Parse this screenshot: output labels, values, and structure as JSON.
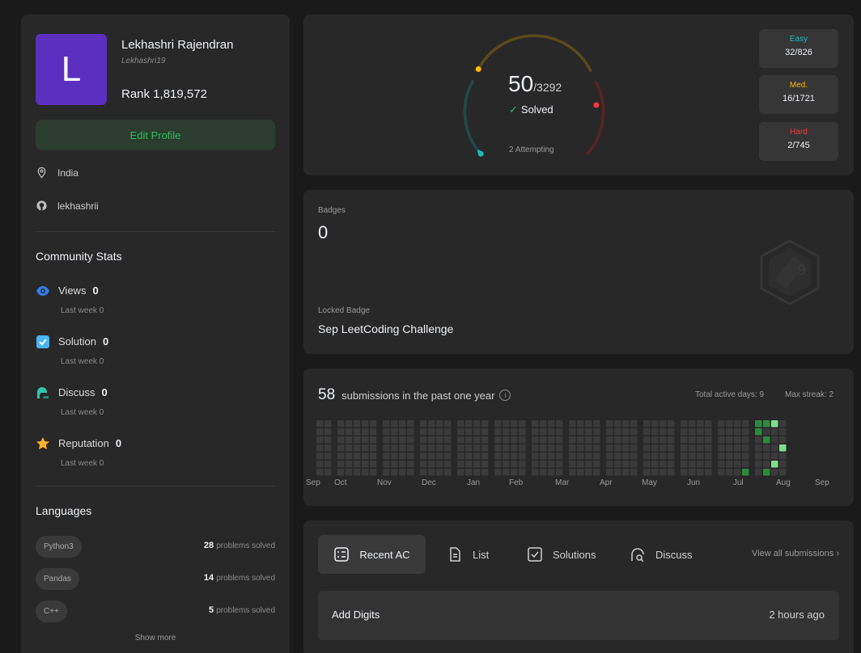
{
  "profile": {
    "avatar_letter": "L",
    "name": "Lekhashri Rajendran",
    "handle": "Lekhashri19",
    "rank": "Rank 1,819,572",
    "edit_label": "Edit Profile",
    "location": "India",
    "github": "lekhashrii"
  },
  "community": {
    "title": "Community Stats",
    "stats": [
      {
        "label": "Views",
        "value": "0",
        "last_week": "Last week 0",
        "icon": "eye-icon",
        "color": "#2f7fe9"
      },
      {
        "label": "Solution",
        "value": "0",
        "last_week": "Last week 0",
        "icon": "checkbox-icon",
        "color": "#4cb3f5"
      },
      {
        "label": "Discuss",
        "value": "0",
        "last_week": "Last week 0",
        "icon": "chat-icon",
        "color": "#2ec5a6"
      },
      {
        "label": "Reputation",
        "value": "0",
        "last_week": "Last week 0",
        "icon": "star-icon",
        "color": "#ffb22c"
      }
    ]
  },
  "languages": {
    "title": "Languages",
    "unit": "problems solved",
    "items": [
      {
        "name": "Python3",
        "count": "28"
      },
      {
        "name": "Pandas",
        "count": "14"
      },
      {
        "name": "C++",
        "count": "5"
      }
    ],
    "show_more": "Show more"
  },
  "solved": {
    "count": "50",
    "total": "/3292",
    "label": "Solved",
    "attempting": "2 Attempting",
    "easy": {
      "label": "Easy",
      "value": "32/826",
      "color": "#1cbaba",
      "solved": 32,
      "total": 826
    },
    "medium": {
      "label": "Med.",
      "value": "16/1721",
      "color": "#ffb700",
      "solved": 16,
      "total": 1721
    },
    "hard": {
      "label": "Hard",
      "value": "2/745",
      "color": "#f63737",
      "solved": 2,
      "total": 745
    }
  },
  "badges": {
    "label": "Badges",
    "count": "0",
    "locked_label": "Locked Badge",
    "locked_name": "Sep LeetCoding Challenge"
  },
  "submissions": {
    "count": "58",
    "label": "submissions in the past one year",
    "active_days": "Total active days: 9",
    "max_streak": "Max streak: 2",
    "months": [
      "Sep",
      "Oct",
      "Nov",
      "Dec",
      "Jan",
      "Feb",
      "Mar",
      "Apr",
      "May",
      "Jun",
      "Jul",
      "Aug",
      "Sep"
    ]
  },
  "recent": {
    "tabs": [
      "Recent AC",
      "List",
      "Solutions",
      "Discuss"
    ],
    "view_all": "View all submissions",
    "items": [
      {
        "title": "Add Digits",
        "time": "2 hours ago"
      }
    ]
  }
}
